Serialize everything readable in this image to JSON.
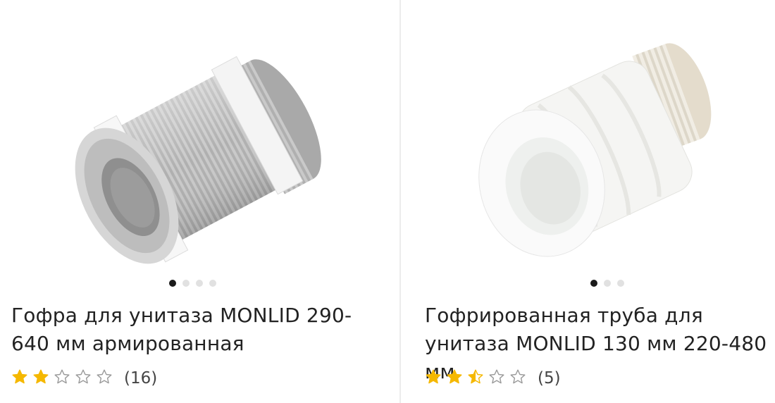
{
  "products": [
    {
      "title": "Гофра для унитаза MONLID 290-640 мм армированная",
      "image_icon": "gray-corrugated-toilet-pipe",
      "slides_total": 4,
      "active_slide": 1,
      "rating": 2,
      "reviews_count": "(16)"
    },
    {
      "title": "Гофрированная труба для унитаза MONLID 130 мм 220-480 мм",
      "image_icon": "white-corrugated-toilet-pipe",
      "slides_total": 3,
      "active_slide": 1,
      "rating": 2.5,
      "reviews_count": "(5)"
    }
  ],
  "colors": {
    "star_fill": "#f5b800",
    "star_outline": "#9a9a9a",
    "dot_active": "#1a1a1a",
    "dot_inactive": "#e1e1e1"
  }
}
